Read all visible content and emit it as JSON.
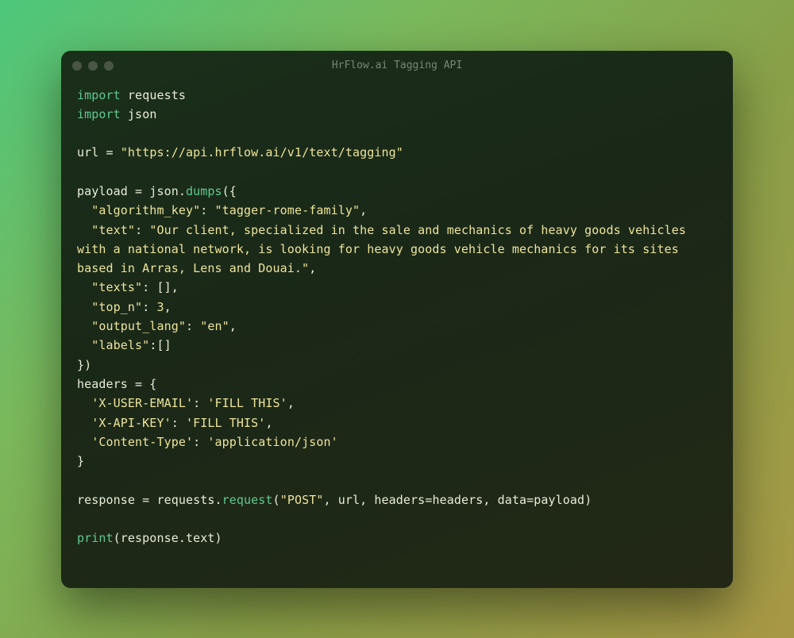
{
  "window": {
    "title": "HrFlow.ai Tagging API"
  },
  "code": {
    "l1_kw": "import",
    "l1_mod": " requests",
    "l2_kw": "import",
    "l2_mod": " json",
    "l4_a": "url = ",
    "l4_str": "\"https://api.hrflow.ai/v1/text/tagging\"",
    "l6_a": "payload = json.",
    "l6_fn": "dumps",
    "l6_b": "({",
    "l7_a": "  ",
    "l7_k": "\"algorithm_key\"",
    "l7_b": ": ",
    "l7_v": "\"tagger-rome-family\"",
    "l7_c": ",",
    "l8_a": "  ",
    "l8_k": "\"text\"",
    "l8_b": ": ",
    "l8_v": "\"Our client, specialized in the sale and mechanics of heavy goods vehicles with a national network, is looking for heavy goods vehicle mechanics for its sites based in Arras, Lens and Douai.\"",
    "l8_c": ",",
    "l9_a": "  ",
    "l9_k": "\"texts\"",
    "l9_b": ": [],",
    "l10_a": "  ",
    "l10_k": "\"top_n\"",
    "l10_b": ": ",
    "l10_v": "3",
    "l10_c": ",",
    "l11_a": "  ",
    "l11_k": "\"output_lang\"",
    "l11_b": ": ",
    "l11_v": "\"en\"",
    "l11_c": ",",
    "l12_a": "  ",
    "l12_k": "\"labels\"",
    "l12_b": ":[]",
    "l13": "})",
    "l14": "headers = {",
    "l15_a": "  ",
    "l15_k": "'X-USER-EMAIL'",
    "l15_b": ": ",
    "l15_v": "'FILL THIS'",
    "l15_c": ",",
    "l16_a": "  ",
    "l16_k": "'X-API-KEY'",
    "l16_b": ": ",
    "l16_v": "'FILL THIS'",
    "l16_c": ",",
    "l17_a": "  ",
    "l17_k": "'Content-Type'",
    "l17_b": ": ",
    "l17_v": "'application/json'",
    "l18": "}",
    "l20_a": "response = requests.",
    "l20_fn": "request",
    "l20_b": "(",
    "l20_s": "\"POST\"",
    "l20_c": ", url, headers=headers, data=payload)",
    "l22_fn": "print",
    "l22_a": "(response.text)"
  }
}
